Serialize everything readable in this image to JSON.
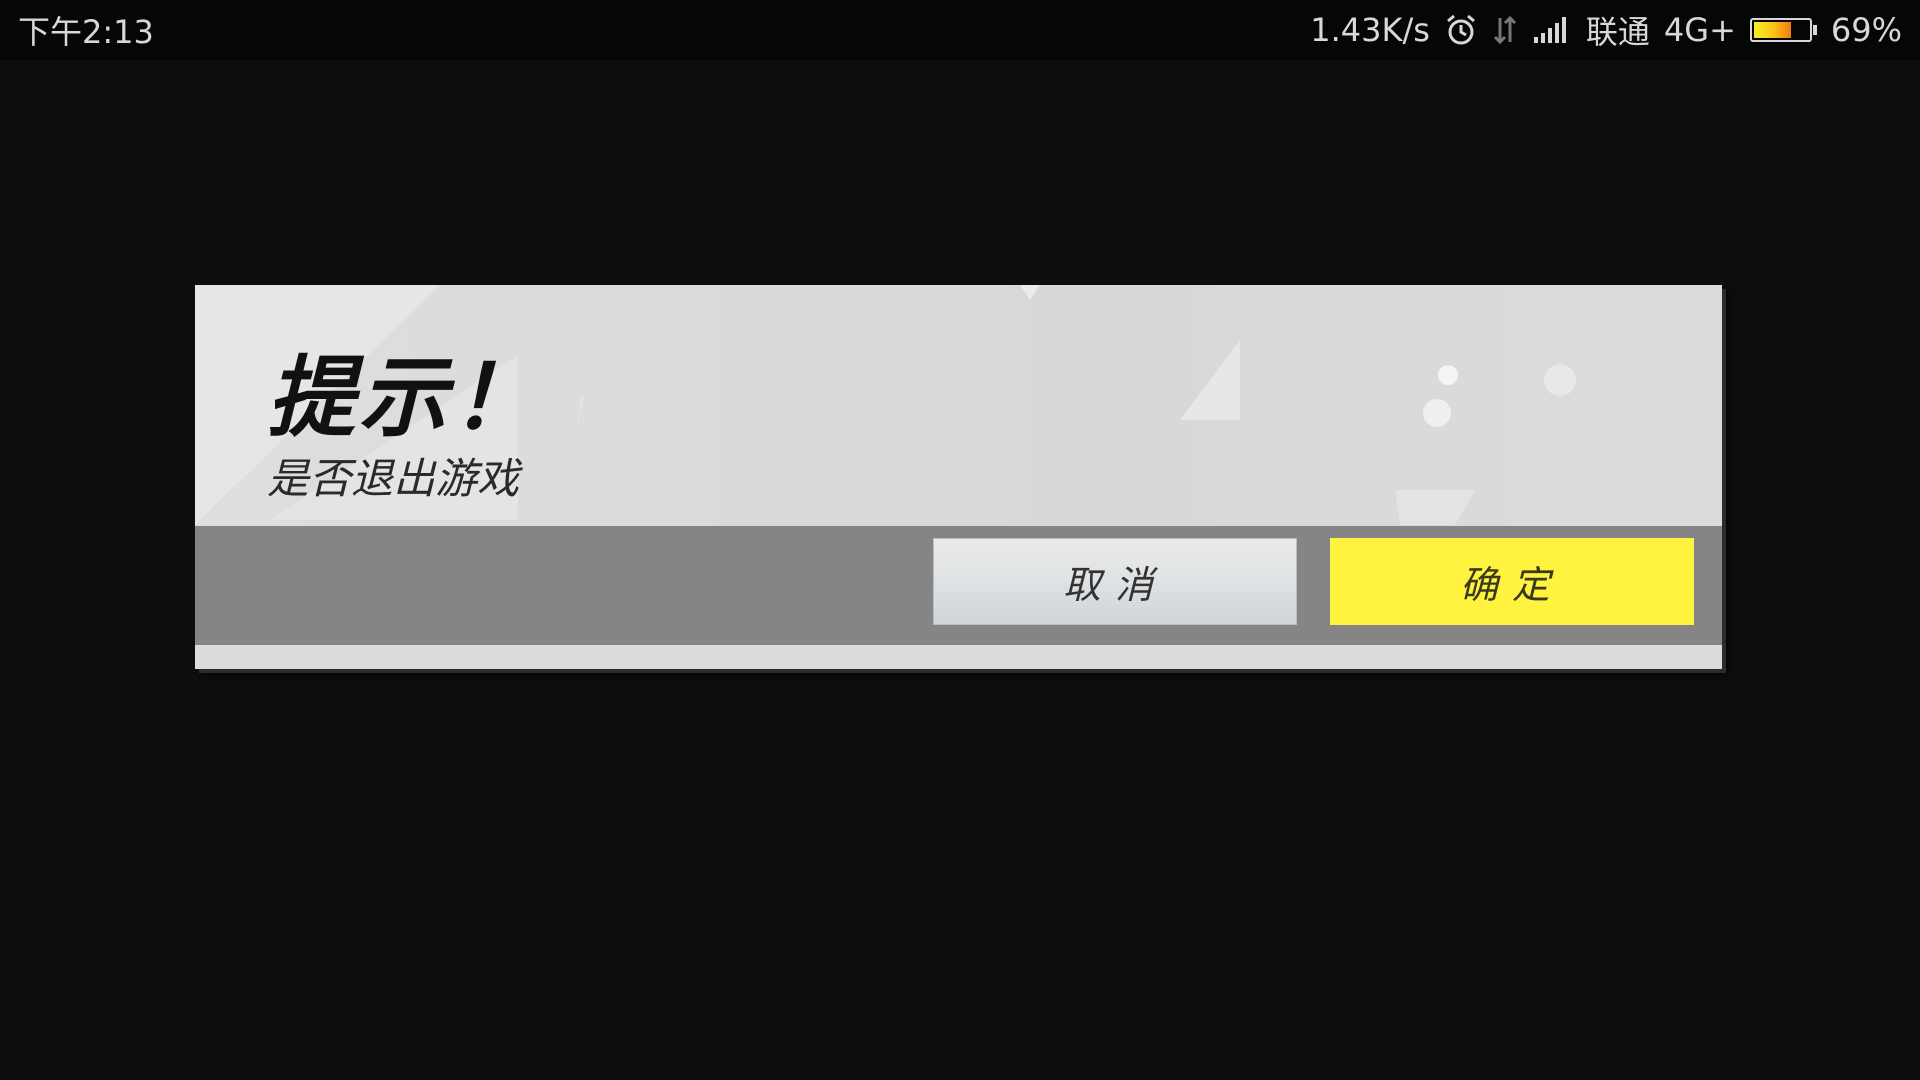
{
  "status_bar": {
    "time": "下午2:13",
    "network_speed": "1.43K/s",
    "carrier": "联通",
    "network_type": "4G+",
    "battery_percent": "69%",
    "battery_level": 0.69,
    "icons": [
      "alarm-icon",
      "data-transfer-icon",
      "signal-icon",
      "battery-icon"
    ]
  },
  "dialog": {
    "title": "提示！",
    "message": "是否退出游戏",
    "cancel_label": "取消",
    "confirm_label": "确定",
    "confirm_color": "#fff33f",
    "bar_color": "#858585",
    "background_color": "#0d0d0d"
  }
}
